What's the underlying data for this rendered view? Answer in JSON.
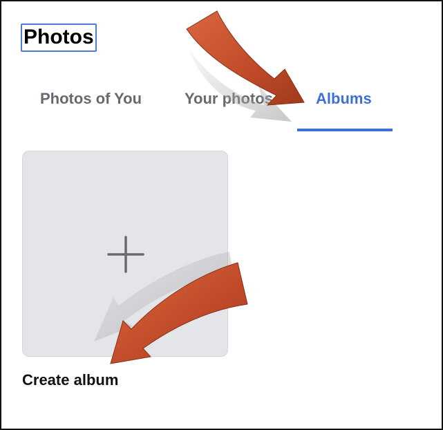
{
  "header": {
    "title": "Photos"
  },
  "tabs": [
    {
      "label": "Photos of You",
      "active": false
    },
    {
      "label": "Your photos",
      "active": false
    },
    {
      "label": "Albums",
      "active": true
    }
  ],
  "albums": {
    "create_tile": {
      "icon": "plus-icon",
      "label": "Create album"
    }
  },
  "colors": {
    "accent": "#3d6fd6",
    "tab_inactive": "#666a70",
    "tile_background": "#e4e5e9",
    "annotation_arrow": "#c4502d"
  }
}
